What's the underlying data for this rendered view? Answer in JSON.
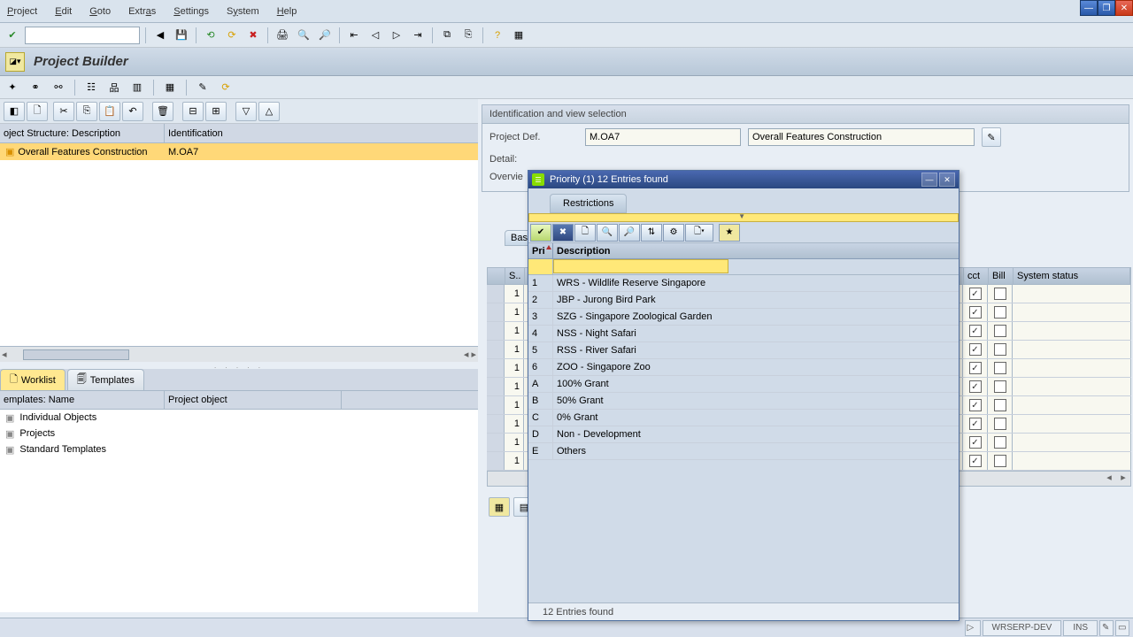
{
  "menu": {
    "items": [
      "Project",
      "Edit",
      "Goto",
      "Extras",
      "Settings",
      "System",
      "Help"
    ],
    "underlines": [
      0,
      0,
      0,
      4,
      0,
      1,
      0
    ]
  },
  "title": "Project Builder",
  "tree": {
    "col1": "oject Structure: Description",
    "col2": "Identification",
    "row": {
      "desc": "Overall Features Construction",
      "id": "M.OA7"
    }
  },
  "worklist": {
    "tab1": "Worklist",
    "tab2": "Templates",
    "col1": "emplates: Name",
    "col2": "Project object",
    "items": [
      "Individual Objects",
      "Projects",
      "Standard Templates"
    ]
  },
  "right": {
    "box_title": "Identification and view selection",
    "projdef_label": "Project Def.",
    "projdef_value": "M.OA7",
    "projdef_desc": "Overall Features Construction",
    "detail_label": "Detail:",
    "overview_label": "Overvie",
    "bas_tab": "Bas"
  },
  "grid": {
    "s_col": "S..",
    "cct_col": "cct",
    "bill_col": "Bill",
    "sys_col": "System status"
  },
  "dialog": {
    "title": "Priority (1)   12 Entries found",
    "tab": "Restrictions",
    "col1": "Pri",
    "col2": "Description",
    "rows": [
      {
        "p": "1",
        "d": "WRS - Wildlife Reserve Singapore"
      },
      {
        "p": "2",
        "d": "JBP - Jurong Bird Park"
      },
      {
        "p": "3",
        "d": "SZG - Singapore Zoological Garden"
      },
      {
        "p": "4",
        "d": "NSS - Night Safari"
      },
      {
        "p": "5",
        "d": "RSS - River Safari"
      },
      {
        "p": "6",
        "d": "ZOO - Singapore Zoo"
      },
      {
        "p": "A",
        "d": "100% Grant"
      },
      {
        "p": "B",
        "d": "50% Grant"
      },
      {
        "p": "C",
        "d": "0% Grant"
      },
      {
        "p": "D",
        "d": "Non - Development"
      },
      {
        "p": "E",
        "d": "Others"
      }
    ],
    "status": "12 Entries found"
  },
  "statusbar": {
    "system": "WRSERP-DEV",
    "mode": "INS"
  }
}
